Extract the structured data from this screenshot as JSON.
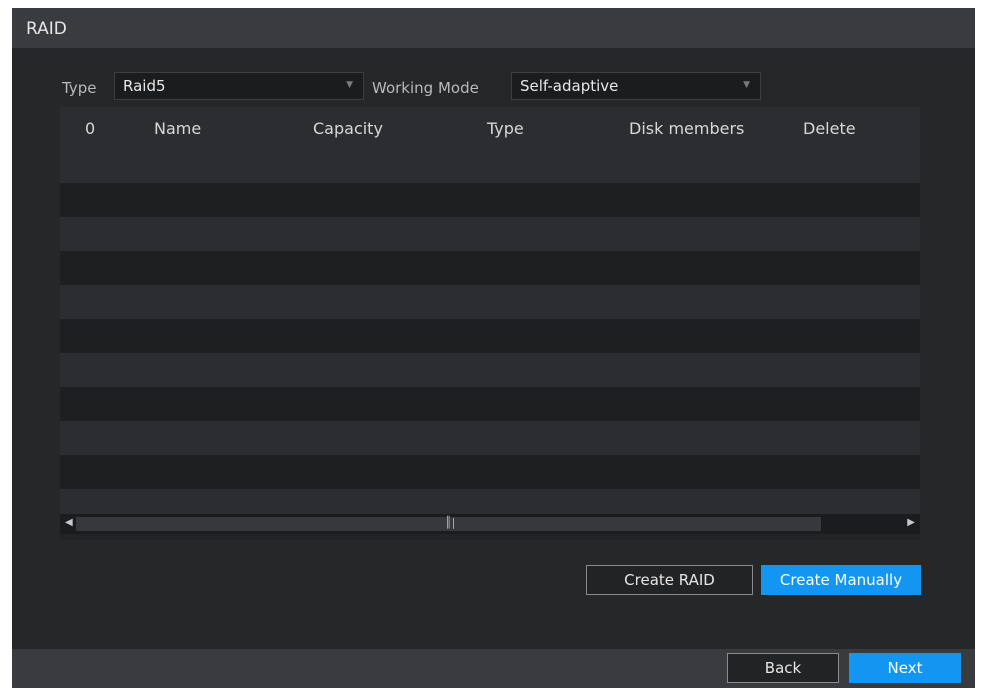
{
  "window": {
    "title": "RAID"
  },
  "filters": {
    "type_label": "Type",
    "type_value": "Raid5",
    "mode_label": "Working Mode",
    "mode_value": "Self-adaptive"
  },
  "table": {
    "columns": [
      "0",
      "Name",
      "Capacity",
      "Type",
      "Disk members",
      "Delete"
    ],
    "rows": []
  },
  "buttons": {
    "create_raid": "Create RAID",
    "create_manually": "Create Manually",
    "back": "Back",
    "next": "Next"
  },
  "icons": {
    "dropdown": "dropdown-arrow-icon",
    "scroll_left": "scroll-left-icon",
    "scroll_right": "scroll-right-icon",
    "grip": "scroll-grip-icon"
  },
  "colors": {
    "accent": "#1296f2",
    "background": "#262729",
    "titlebar": "#3a3b3e"
  }
}
